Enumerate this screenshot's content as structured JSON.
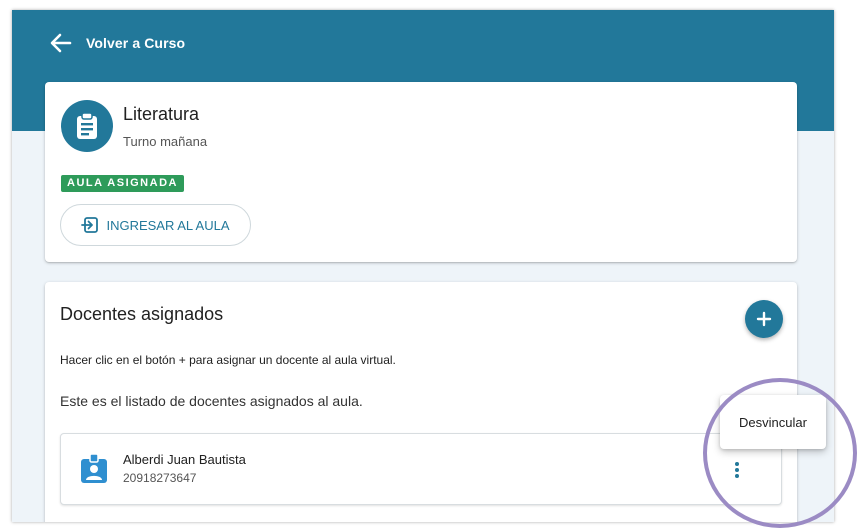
{
  "header": {
    "back_label": "Volver a Curso"
  },
  "course": {
    "title": "Literatura",
    "subtitle": "Turno mañana",
    "status_badge": "AULA ASIGNADA",
    "enter_button_label": "INGRESAR AL AULA"
  },
  "teachers": {
    "section_title": "Docentes asignados",
    "hint": "Hacer clic en el botón + para asignar un docente al aula virtual.",
    "list_description": "Este es el listado de docentes asignados al aula.",
    "items": [
      {
        "name": "Alberdi Juan Bautista",
        "id": "20918273647"
      }
    ]
  },
  "context_menu": {
    "items": [
      {
        "label": "Desvincular"
      }
    ]
  },
  "colors": {
    "primary": "#22789a",
    "badge_green": "#2e9b5a",
    "teacher_icon": "#2f8fd0",
    "highlight_ring": "#9b8bc4"
  },
  "icons": {
    "back": "arrow-left-icon",
    "course": "clipboard-icon",
    "enter": "login-icon",
    "add": "plus-icon",
    "teacher": "badge-account-icon",
    "more": "dots-vertical-icon"
  }
}
